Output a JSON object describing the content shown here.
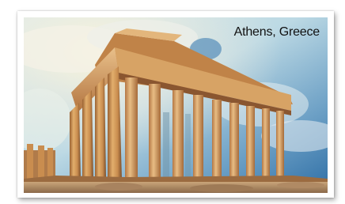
{
  "caption": {
    "text": "Athens, Greece"
  },
  "colors": {
    "sky_top": "#cfe3ea",
    "sky_blue": "#3f7fb3",
    "cloud": "#f2f2ea",
    "stone_light": "#e6b879",
    "stone_mid": "#c98d4f",
    "stone_dark": "#7a4d2a",
    "shadow": "#4a2e1a"
  },
  "icons": {
    "photo": "parthenon-photo"
  }
}
